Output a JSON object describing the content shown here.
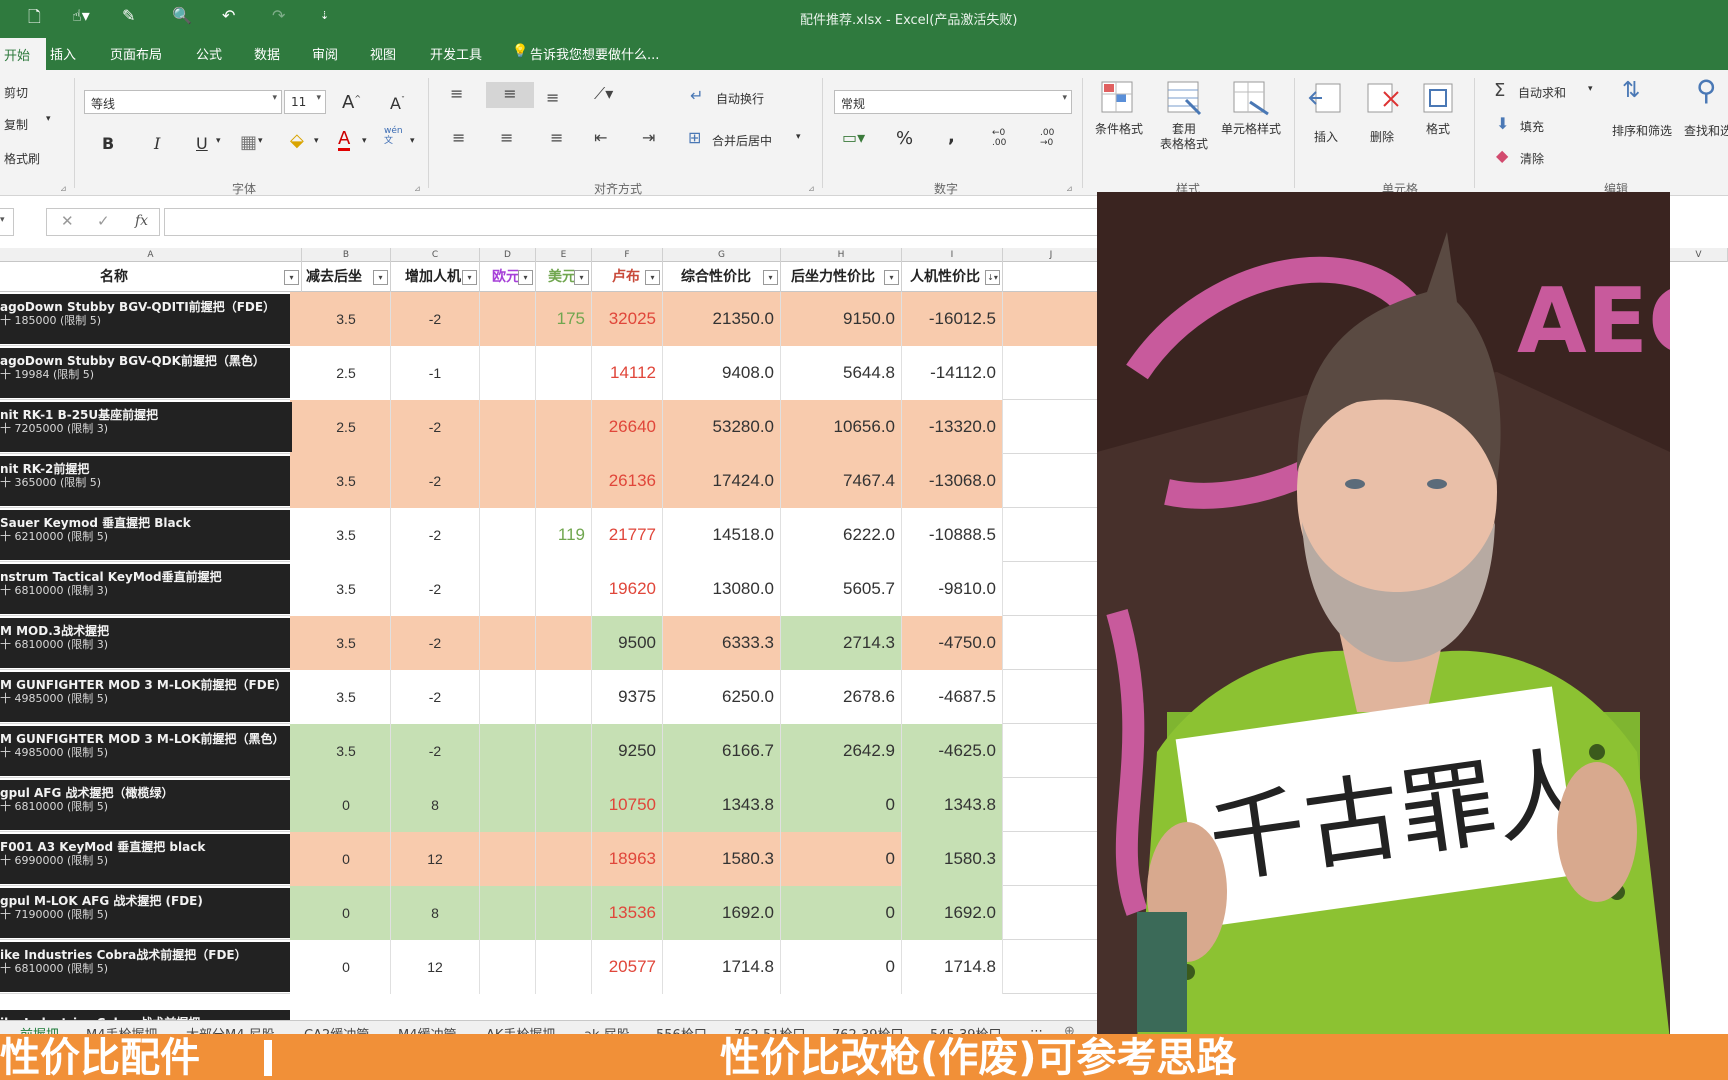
{
  "window": {
    "title": "配件推荐.xlsx - Excel(产品激活失败)"
  },
  "tabs": [
    "开始",
    "插入",
    "页面布局",
    "公式",
    "数据",
    "审阅",
    "视图",
    "开发工具"
  ],
  "tell_me": "告诉我您想要做什么...",
  "ribbon": {
    "clipboard": {
      "cut": "剪切",
      "copy": "复制",
      "painter": "格式刷"
    },
    "font": {
      "name": "等线",
      "size": "11",
      "bold": "B",
      "italic": "I",
      "underline": "U",
      "color_a": "A",
      "phonetic": "wén\n文",
      "group": "字体",
      "inc": "A",
      "dec": "A"
    },
    "align": {
      "wrap": "自动换行",
      "merge": "合并后居中",
      "group": "对齐方式"
    },
    "number": {
      "format": "常规",
      "percent": "%",
      "comma": ",",
      "inc_dec": "←0\n.00",
      "dec_dec": ".00\n→0",
      "group": "数字"
    },
    "styles": {
      "cond": "条件格式",
      "table": "套用\n表格格式",
      "cell": "单元格样式",
      "group": "样式"
    },
    "cells": {
      "insert": "插入",
      "delete": "删除",
      "format": "格式",
      "group": "单元格"
    },
    "edit": {
      "autosum": "自动求和",
      "fill": "填充",
      "clear": "清除",
      "sort": "排序和筛选",
      "find": "查找和选",
      "group": "编辑"
    }
  },
  "formula": {
    "cancel": "✕",
    "enter": "✓",
    "fx": "fx"
  },
  "columns": [
    "A",
    "B",
    "C",
    "D",
    "E",
    "F",
    "G",
    "H",
    "I",
    "J",
    "V"
  ],
  "headers": [
    "名称",
    "减去后坐",
    "增加人机",
    "欧元",
    "美元",
    "卢布",
    "综合性价比",
    "后坐力性价比",
    "人机性价比"
  ],
  "rows": [
    {
      "name": "agoDown Stubby BGV-QDITI前握把（FDE）",
      "sub": "十 185000 (限制 5)",
      "b": "3.5",
      "c": "-2",
      "d": "",
      "e": "175",
      "f": "32025",
      "g": "21350.0",
      "h": "9150.0",
      "i": "-16012.5",
      "fill": "#f8cbad"
    },
    {
      "name": "agoDown Stubby BGV-QDK前握把（黑色）",
      "sub": "十 19984 (限制 5)",
      "b": "2.5",
      "c": "-1",
      "d": "",
      "e": "",
      "f": "14112",
      "g": "9408.0",
      "h": "5644.8",
      "i": "-14112.0",
      "fill": "#ffffff"
    },
    {
      "name": "nit RK-1 B-25U基座前握把",
      "sub": "十 7205000 (限制 3)",
      "b": "2.5",
      "c": "-2",
      "d": "",
      "e": "",
      "f": "26640",
      "g": "53280.0",
      "h": "10656.0",
      "i": "-13320.0",
      "fill": "#f8cbad"
    },
    {
      "name": "nit RK-2前握把",
      "sub": "十 365000 (限制 5)",
      "b": "3.5",
      "c": "-2",
      "d": "",
      "e": "",
      "f": "26136",
      "g": "17424.0",
      "h": "7467.4",
      "i": "-13068.0",
      "fill": "#f8cbad"
    },
    {
      "name": "Sauer Keymod 垂直握把 Black",
      "sub": "十 6210000 (限制 5)",
      "b": "3.5",
      "c": "-2",
      "d": "",
      "e": "119",
      "f": "21777",
      "g": "14518.0",
      "h": "6222.0",
      "i": "-10888.5",
      "fill": "#ffffff"
    },
    {
      "name": "nstrum Tactical KeyMod垂直前握把",
      "sub": "十 6810000 (限制 3)",
      "b": "3.5",
      "c": "-2",
      "d": "",
      "e": "",
      "f": "19620",
      "g": "13080.0",
      "h": "5605.7",
      "i": "-9810.0",
      "fill": "#ffffff"
    },
    {
      "name": "M MOD.3战术握把",
      "sub": "十 6810000 (限制 3)",
      "b": "3.5",
      "c": "-2",
      "d": "",
      "e": "",
      "f": "9500",
      "g": "6333.3",
      "h": "2714.3",
      "i": "-4750.0",
      "fill": "#f8cbad"
    },
    {
      "name": "M GUNFIGHTER MOD 3 M-LOK前握把（FDE）",
      "sub": "十 4985000 (限制 5)",
      "b": "3.5",
      "c": "-2",
      "d": "",
      "e": "",
      "f": "9375",
      "g": "6250.0",
      "h": "2678.6",
      "i": "-4687.5",
      "fill": "#ffffff"
    },
    {
      "name": "M GUNFIGHTER MOD 3 M-LOK前握把（黑色）",
      "sub": "十 4985000 (限制 5)",
      "b": "3.5",
      "c": "-2",
      "d": "",
      "e": "",
      "f": "9250",
      "g": "6166.7",
      "h": "2642.9",
      "i": "-4625.0",
      "fill": "#c6e0b4"
    },
    {
      "name": "gpul AFG 战术握把（橄榄绿）",
      "sub": "十 6810000 (限制 5)",
      "b": "0",
      "c": "8",
      "d": "",
      "e": "",
      "f": "10750",
      "g": "1343.8",
      "h": "0",
      "i": "1343.8",
      "fill": "#c6e0b4"
    },
    {
      "name": "F001 A3 KeyMod 垂直握把 black",
      "sub": "十 6990000 (限制 5)",
      "b": "0",
      "c": "12",
      "d": "",
      "e": "",
      "f": "18963",
      "g": "1580.3",
      "h": "0",
      "i": "1580.3",
      "fill": "#f8cbad"
    },
    {
      "name": "gpul M-LOK AFG 战术握把 (FDE)",
      "sub": "十 7190000 (限制 5)",
      "b": "0",
      "c": "8",
      "d": "",
      "e": "",
      "f": "13536",
      "g": "1692.0",
      "h": "0",
      "i": "1692.0",
      "fill": "#c6e0b4"
    },
    {
      "name": "ike Industries Cobra战术前握把（FDE）",
      "sub": "十 6810000 (限制 5)",
      "b": "0",
      "c": "12",
      "d": "",
      "e": "",
      "f": "20577",
      "g": "1714.8",
      "h": "0",
      "i": "1714.8",
      "fill": "#ffffff"
    }
  ],
  "partial_row_name": "ike Industries Cobra 战术前握把",
  "sheets": [
    "前握把",
    "M4手枪握把",
    "大部分M4 尼股",
    "CA2缓冲管",
    "M4缓冲管",
    "AK手枪握把",
    "ak 屁股",
    "556枪口",
    "762 51枪口",
    "762 39枪口",
    "545 39枪口"
  ],
  "sheet_more": "⋯",
  "sign": {
    "text": "千古罪人"
  },
  "banner": {
    "left": "性价比配件",
    "right": "性价比改枪(作废)可参考思路"
  },
  "colors": {
    "excel_green": "#2f7a3e",
    "peach": "#f8cbad",
    "green": "#c6e0b4",
    "red_text": "#e0463a",
    "green_text": "#70a64f",
    "banner": "#f19038"
  }
}
